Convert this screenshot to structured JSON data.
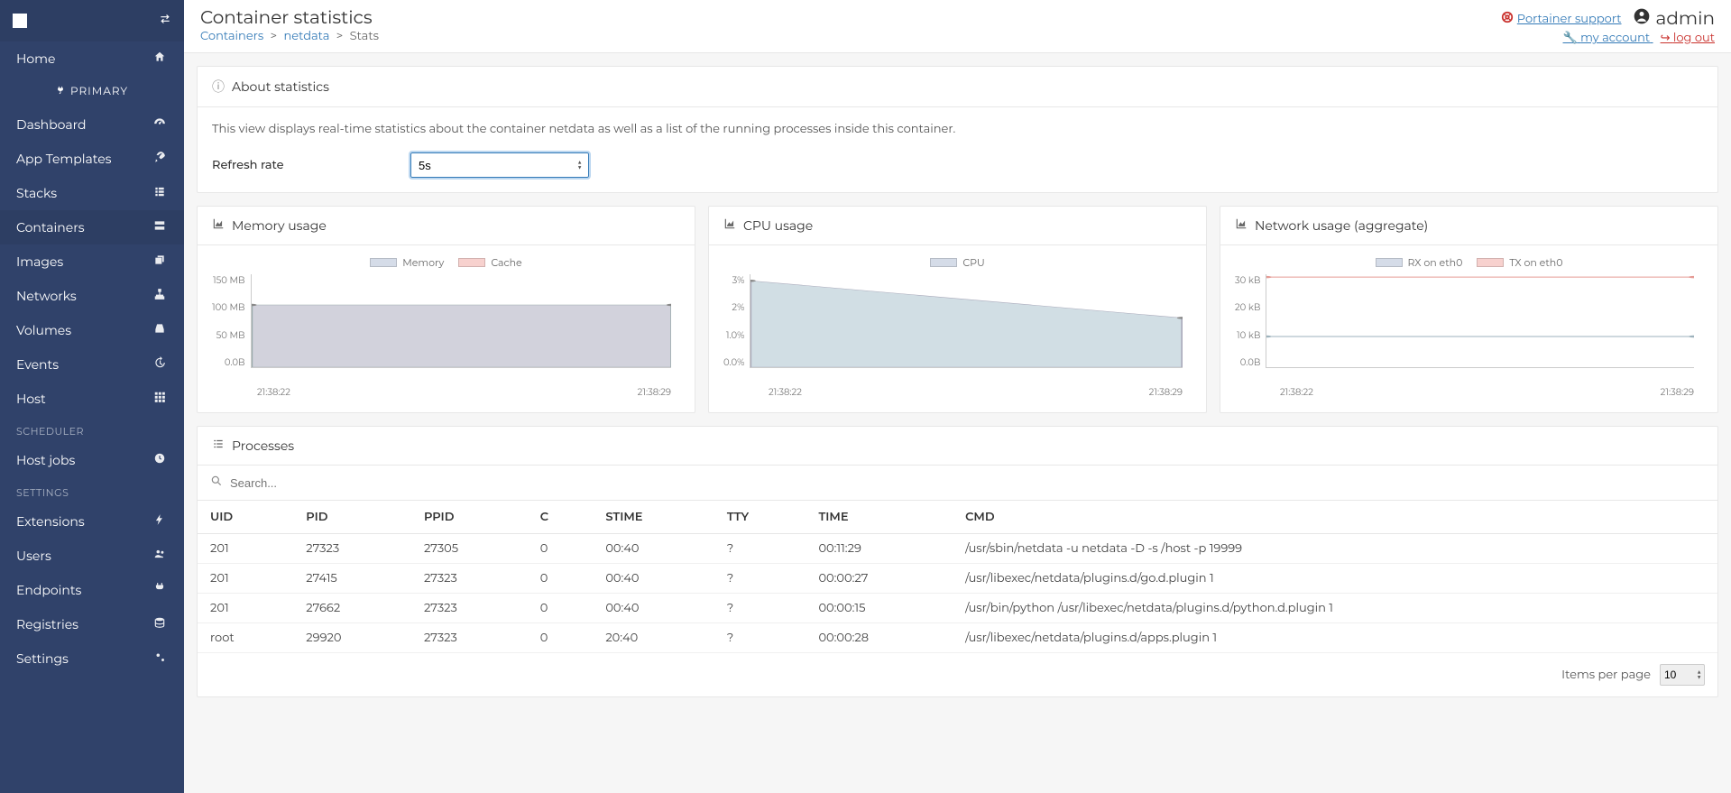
{
  "sidebar": {
    "primary_label": "PRIMARY",
    "items": [
      {
        "label": "Home",
        "icon": "home"
      },
      {
        "label": "Dashboard",
        "icon": "gauge"
      },
      {
        "label": "App Templates",
        "icon": "rocket"
      },
      {
        "label": "Stacks",
        "icon": "list"
      },
      {
        "label": "Containers",
        "icon": "server"
      },
      {
        "label": "Images",
        "icon": "clone"
      },
      {
        "label": "Networks",
        "icon": "sitemap"
      },
      {
        "label": "Volumes",
        "icon": "database"
      },
      {
        "label": "Events",
        "icon": "history"
      },
      {
        "label": "Host",
        "icon": "th"
      }
    ],
    "scheduler_label": "SCHEDULER",
    "scheduler_items": [
      {
        "label": "Host jobs",
        "icon": "clock"
      }
    ],
    "settings_label": "SETTINGS",
    "settings_items": [
      {
        "label": "Extensions",
        "icon": "bolt"
      },
      {
        "label": "Users",
        "icon": "users"
      },
      {
        "label": "Endpoints",
        "icon": "plug"
      },
      {
        "label": "Registries",
        "icon": "database"
      },
      {
        "label": "Settings",
        "icon": "cogs"
      }
    ]
  },
  "header": {
    "title": "Container statistics",
    "breadcrumb": {
      "containers": "Containers",
      "container_name": "netdata",
      "current": "Stats"
    },
    "support": "Portainer support",
    "user": "admin",
    "my_account": "my account",
    "log_out": "log out"
  },
  "about": {
    "title": "About statistics",
    "text": "This view displays real-time statistics about the container netdata as well as a list of the running processes inside this container.",
    "refresh_label": "Refresh rate",
    "refresh_value": "5s"
  },
  "charts": {
    "memory": {
      "title": "Memory usage",
      "legend": [
        "Memory",
        "Cache"
      ],
      "ylabels": [
        "150 MB",
        "100 MB",
        "50 MB",
        "0.0B"
      ],
      "xlabels": [
        "21:38:22",
        "21:38:29"
      ]
    },
    "cpu": {
      "title": "CPU usage",
      "legend": [
        "CPU"
      ],
      "ylabels": [
        "3%",
        "2%",
        "1.0%",
        "0.0%"
      ],
      "xlabels": [
        "21:38:22",
        "21:38:29"
      ]
    },
    "network": {
      "title": "Network usage (aggregate)",
      "legend": [
        "RX on eth0",
        "TX on eth0"
      ],
      "ylabels": [
        "30 kB",
        "20 kB",
        "10 kB",
        "0.0B"
      ],
      "xlabels": [
        "21:38:22",
        "21:38:29"
      ]
    }
  },
  "chart_data": [
    {
      "type": "area",
      "title": "Memory usage",
      "x": [
        "21:38:22",
        "21:38:29"
      ],
      "series": [
        {
          "name": "Memory",
          "values": [
            100,
            100
          ],
          "unit": "MB",
          "color": "#c7c7d3"
        },
        {
          "name": "Cache",
          "values": [
            0,
            0
          ],
          "unit": "MB",
          "color": "#f5b7b1"
        }
      ],
      "ylim": [
        0,
        150
      ],
      "ylabel": "MB"
    },
    {
      "type": "area",
      "title": "CPU usage",
      "x": [
        "21:38:22",
        "21:38:29"
      ],
      "series": [
        {
          "name": "CPU",
          "values": [
            2.8,
            1.6
          ],
          "unit": "%",
          "color": "#c9d8df"
        }
      ],
      "ylim": [
        0,
        3
      ],
      "ylabel": "%"
    },
    {
      "type": "line",
      "title": "Network usage (aggregate)",
      "x": [
        "21:38:22",
        "21:38:29"
      ],
      "series": [
        {
          "name": "RX on eth0",
          "values": [
            10,
            10
          ],
          "unit": "kB",
          "color": "#c9d8df"
        },
        {
          "name": "TX on eth0",
          "values": [
            29,
            29
          ],
          "unit": "kB",
          "color": "#f5b7b1"
        }
      ],
      "ylim": [
        0,
        30
      ],
      "ylabel": "kB"
    }
  ],
  "processes": {
    "title": "Processes",
    "search_placeholder": "Search...",
    "columns": [
      "UID",
      "PID",
      "PPID",
      "C",
      "STIME",
      "TTY",
      "TIME",
      "CMD"
    ],
    "rows": [
      [
        "201",
        "27323",
        "27305",
        "0",
        "00:40",
        "?",
        "00:11:29",
        "/usr/sbin/netdata -u netdata -D -s /host -p 19999"
      ],
      [
        "201",
        "27415",
        "27323",
        "0",
        "00:40",
        "?",
        "00:00:27",
        "/usr/libexec/netdata/plugins.d/go.d.plugin 1"
      ],
      [
        "201",
        "27662",
        "27323",
        "0",
        "00:40",
        "?",
        "00:00:15",
        "/usr/bin/python /usr/libexec/netdata/plugins.d/python.d.plugin 1"
      ],
      [
        "root",
        "29920",
        "27323",
        "0",
        "20:40",
        "?",
        "00:00:28",
        "/usr/libexec/netdata/plugins.d/apps.plugin 1"
      ]
    ],
    "items_per_page_label": "Items per page",
    "items_per_page_value": "10"
  }
}
